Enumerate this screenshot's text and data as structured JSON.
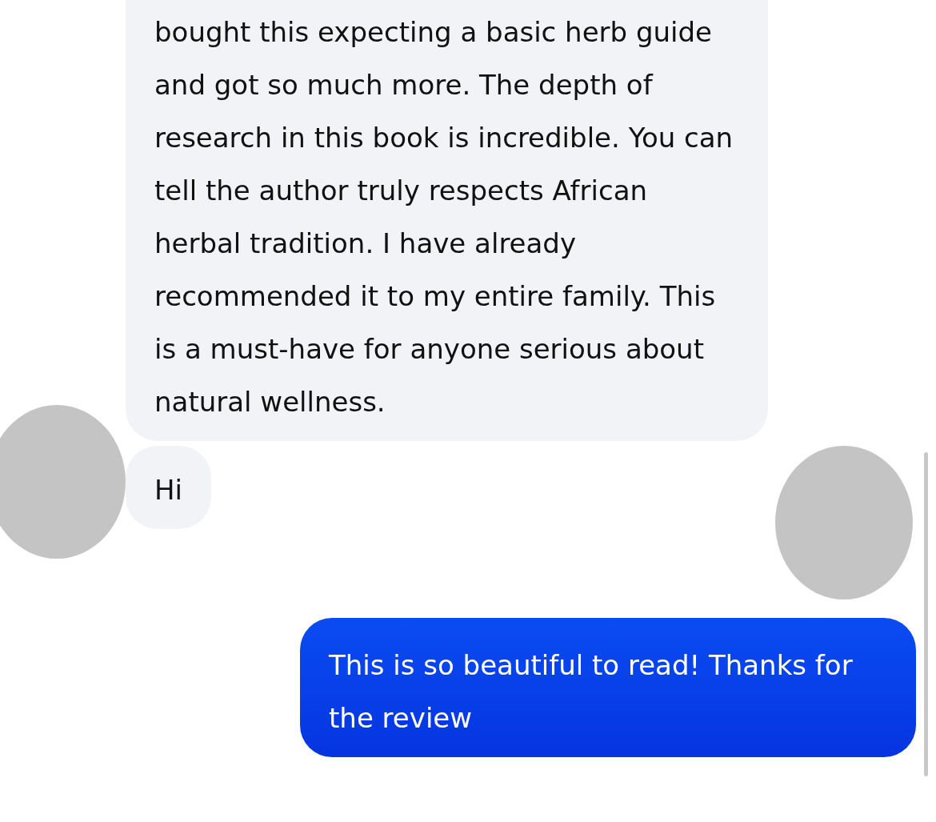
{
  "messages": [
    {
      "kind": "received",
      "text": "bought this expecting a basic herb guide and got so much more. The depth of research in this book is incredible. You can tell the author truly respects African herbal tradition. I have already recommended it to my entire family. This is a must-have for anyone serious about natural wellness.",
      "avatar": false
    },
    {
      "kind": "received",
      "text": "Hi",
      "avatar": true
    },
    {
      "kind": "sent",
      "text": "This is so beautiful to read! Thanks for the review",
      "avatar": true
    }
  ]
}
